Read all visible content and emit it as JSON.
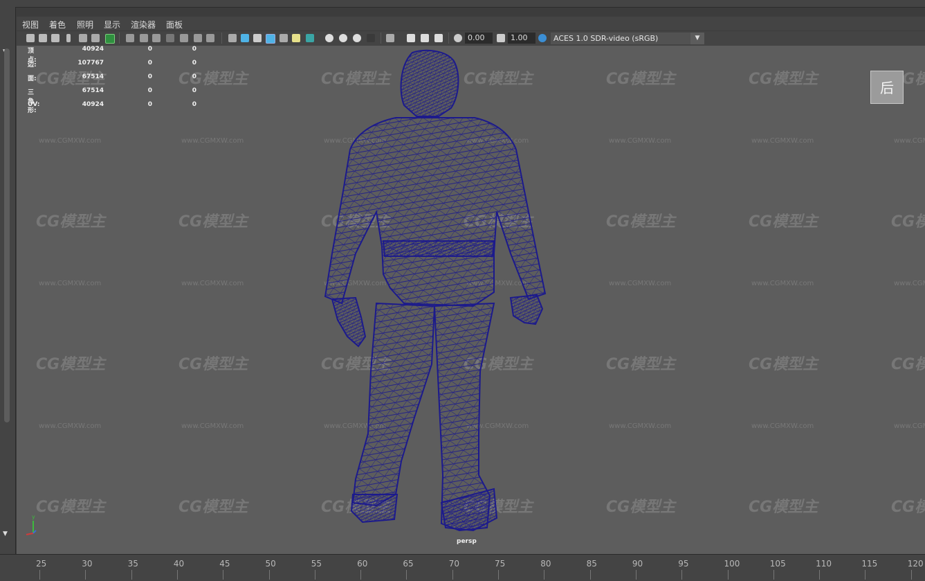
{
  "menu": {
    "items": [
      "视图",
      "着色",
      "照明",
      "显示",
      "渲染器",
      "面板"
    ]
  },
  "toolbar": {
    "field1_value": "0.00",
    "field2_value": "1.00",
    "colorspace": "ACES 1.0 SDR-video (sRGB)"
  },
  "hud": {
    "rows": [
      {
        "label": "顶点:",
        "v1": "40924",
        "v2": "0",
        "v3": "0"
      },
      {
        "label": "边:",
        "v1": "107767",
        "v2": "0",
        "v3": "0"
      },
      {
        "label": "面:",
        "v1": "67514",
        "v2": "0",
        "v3": "0"
      },
      {
        "label": "三角形:",
        "v1": "67514",
        "v2": "0",
        "v3": "0"
      },
      {
        "label": "UV:",
        "v1": "40924",
        "v2": "0",
        "v3": "0"
      }
    ]
  },
  "viewport": {
    "camera": "persp",
    "viewcube_label": "后",
    "axis_y": "y",
    "wireframe_color": "#1c1a8c",
    "background": "#5d5d5d"
  },
  "watermark": {
    "logo": "CG模型主",
    "url": "www.CGMXW.com"
  },
  "timeline": {
    "ticks": [
      "25",
      "30",
      "35",
      "40",
      "45",
      "50",
      "55",
      "60",
      "65",
      "70",
      "75",
      "80",
      "85",
      "90",
      "95",
      "100",
      "105",
      "110",
      "115",
      "120"
    ]
  }
}
